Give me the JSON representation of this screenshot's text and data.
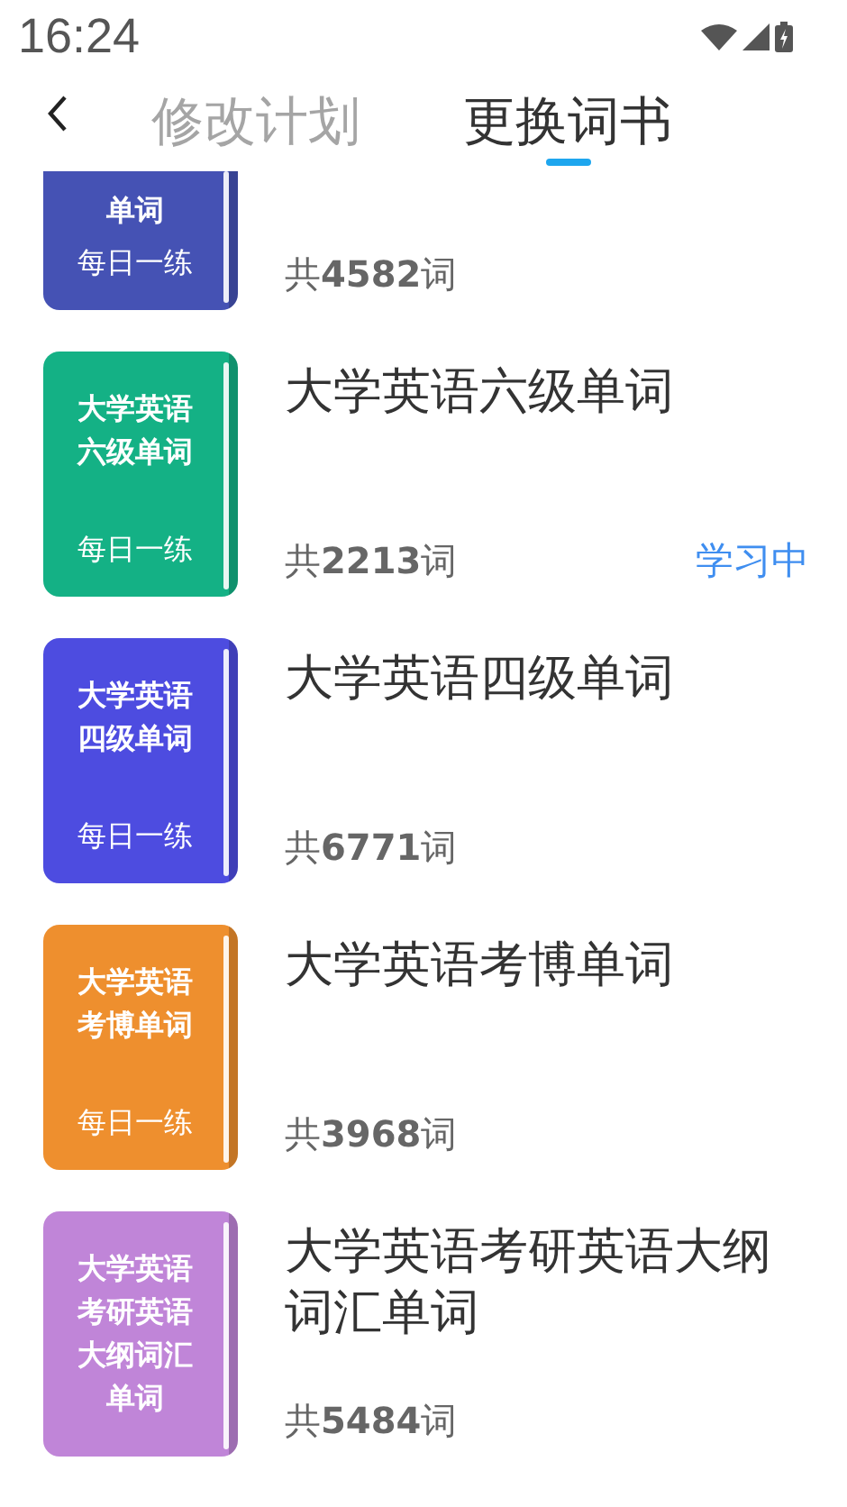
{
  "status_bar": {
    "time": "16:24"
  },
  "tabs": [
    {
      "label": "修改计划",
      "selected": false
    },
    {
      "label": "更换词书",
      "selected": true
    }
  ],
  "books": [
    {
      "kind": "partial",
      "color": "#4552b4",
      "cover_lines": [
        "单词"
      ],
      "tagline": "每日一练",
      "count": "共**4582**词"
    },
    {
      "kind": "full",
      "color": "#14b185",
      "cover_lines": [
        "大学英语",
        "六级单词"
      ],
      "tagline": "每日一练",
      "title": "大学英语六级单词",
      "count": "共**2213**词",
      "status": "学习中"
    },
    {
      "kind": "full",
      "color": "#4d4ce0",
      "cover_lines": [
        "大学英语",
        "四级单词"
      ],
      "tagline": "每日一练",
      "title": "大学英语四级单词",
      "count": "共**6771**词"
    },
    {
      "kind": "full",
      "color": "#ee8f2e",
      "cover_lines": [
        "大学英语",
        "考博单词"
      ],
      "tagline": "每日一练",
      "title": "大学英语考博单词",
      "count": "共**3968**词"
    },
    {
      "kind": "full",
      "color": "#c085d8",
      "cover_lines": [
        "大学英语",
        "考研英语",
        "大纲词汇",
        "单词"
      ],
      "title": "大学英语考研英语大纲词汇单词",
      "count": "共**5484**词"
    }
  ]
}
